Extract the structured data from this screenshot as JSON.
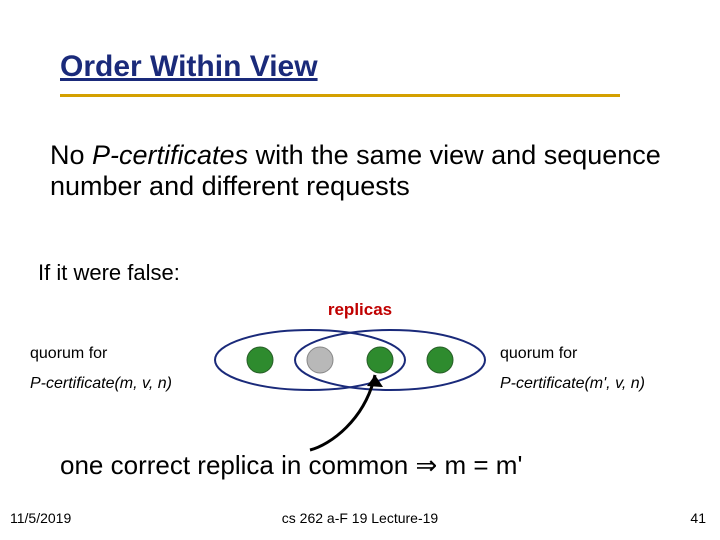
{
  "title": "Order Within View",
  "body": {
    "prefix": "No ",
    "italic": "P-certificates",
    "rest": " with the same view and sequence number and different requests"
  },
  "subtext": "If it were false:",
  "replicas_label": "replicas",
  "left": {
    "quorum": "quorum for",
    "pcert": "P-certificate(m, v, n)"
  },
  "right": {
    "quorum": "quorum for",
    "pcert": "P-certificate(m', v, n)"
  },
  "conclusion": {
    "part1": "one correct replica in common ",
    "implies": "⇒",
    "part2": " m = m'"
  },
  "footer": {
    "date": "11/5/2019",
    "center": "cs 262 a-F 19 Lecture-19",
    "pagenum": "41"
  },
  "diagram": {
    "colors": {
      "ellipse_stroke": "#1a2a7a",
      "green": "#2e8b2e",
      "grey": "#b8b8b8",
      "arrow": "#000000"
    }
  }
}
